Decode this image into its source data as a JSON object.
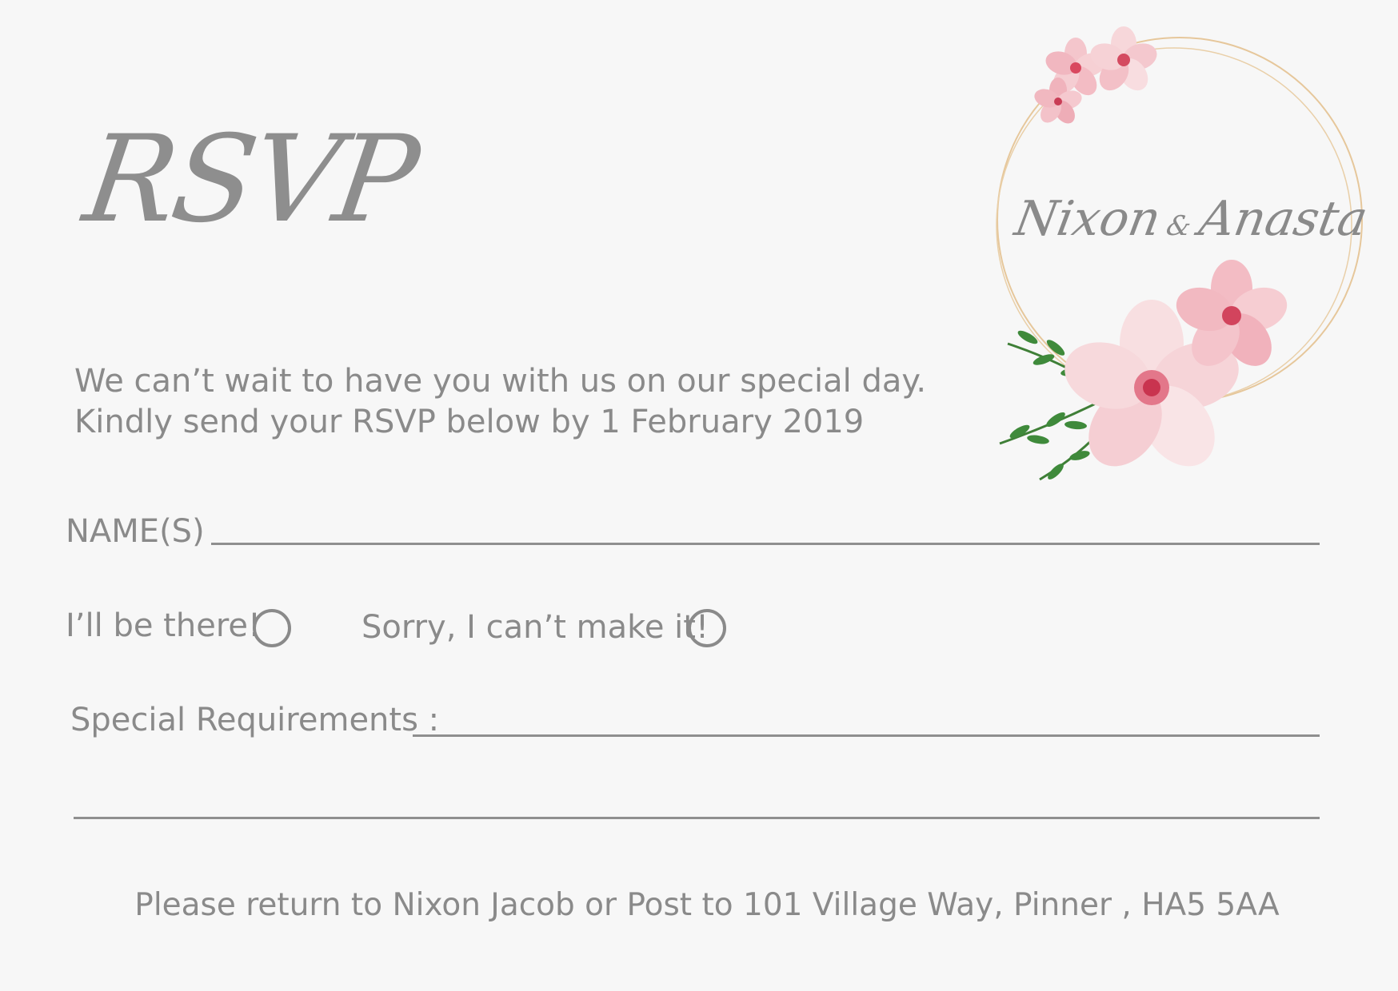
{
  "title": "RSVP",
  "couple": {
    "name_one": "Nixon",
    "ampersand": "&",
    "name_two": "Anasta"
  },
  "intro": {
    "line1": "We can’t wait to have you with us on our special day.",
    "line2": "Kindly send your RSVP below by 1 February 2019"
  },
  "form": {
    "names_label": "NAME(S)",
    "attending_label": "I’ll be there!",
    "declining_label": "Sorry, I can’t make it!",
    "requirements_label": "Special Requirements :"
  },
  "footer": "Please return to Nixon Jacob or Post to 101 Village Way, Pinner , HA5 5AA",
  "colors": {
    "text": "#8a8a8a",
    "background": "#f7f7f7",
    "ring": "#e2bf8f",
    "petal": "#f2c2c8",
    "petal_center": "#d9485f",
    "leaf": "#3e8a3a"
  }
}
